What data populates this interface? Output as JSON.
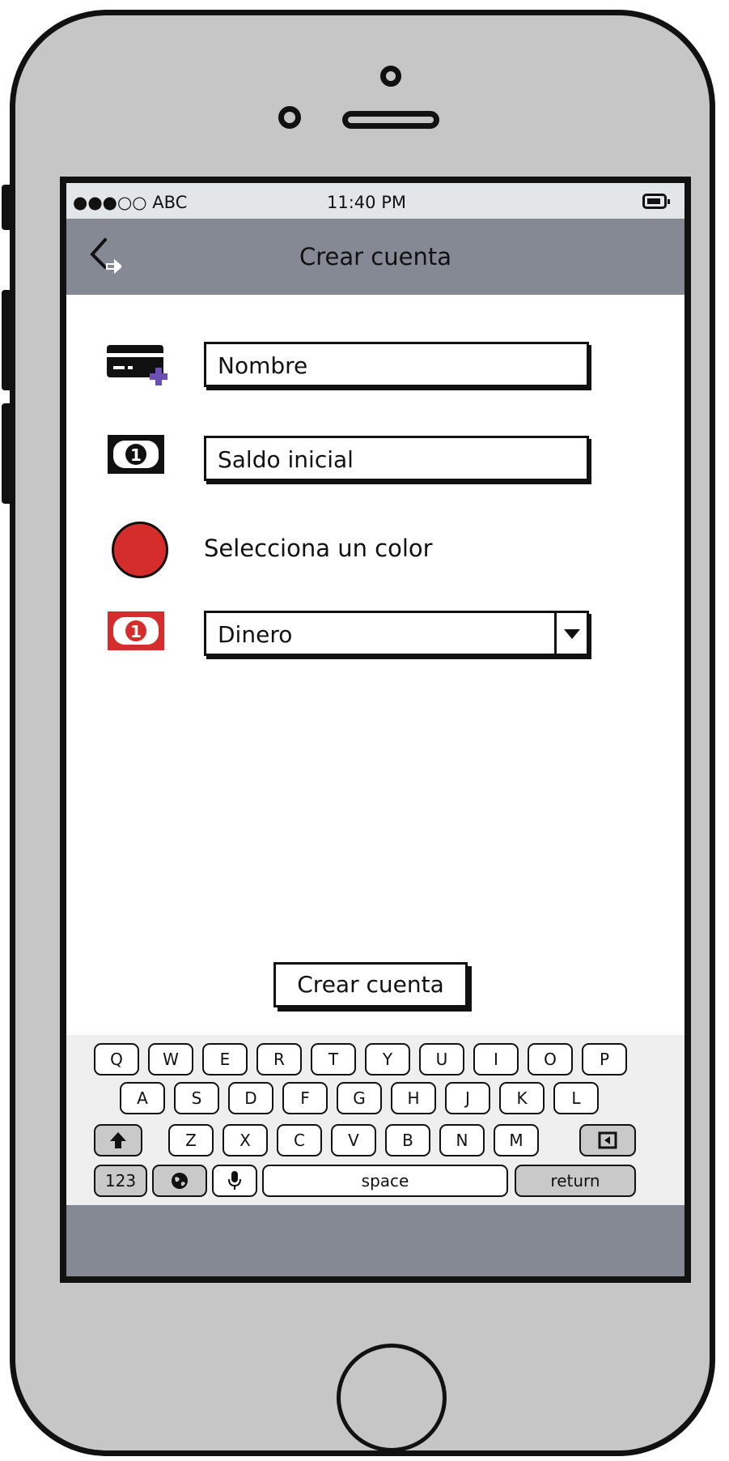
{
  "status_bar": {
    "carrier": "●●●○○ ABC",
    "time": "11:40 PM"
  },
  "nav": {
    "title": "Crear cuenta"
  },
  "form": {
    "name_placeholder": "Nombre",
    "balance_placeholder": "Saldo inicial",
    "color_label": "Selecciona un color",
    "selected_color": "#d52c2c",
    "currency_value": "Dinero"
  },
  "create_button": {
    "label": "Crear cuenta"
  },
  "keyboard": {
    "row1": [
      "Q",
      "W",
      "E",
      "R",
      "T",
      "Y",
      "U",
      "I",
      "O",
      "P"
    ],
    "row2": [
      "A",
      "S",
      "D",
      "F",
      "G",
      "H",
      "J",
      "K",
      "L"
    ],
    "row3": [
      "Z",
      "X",
      "C",
      "V",
      "B",
      "N",
      "M"
    ],
    "numbers_key": "123",
    "space_key": "space",
    "return_key": "return"
  },
  "icons": {
    "back": "back-chevron-icon",
    "card_add": "credit-card-plus-icon",
    "banknote": "banknote-icon",
    "currency_banknote": "red-banknote-icon",
    "shift": "shift-arrow-icon",
    "globe": "globe-icon",
    "mic": "mic-icon",
    "backspace": "backspace-icon"
  }
}
